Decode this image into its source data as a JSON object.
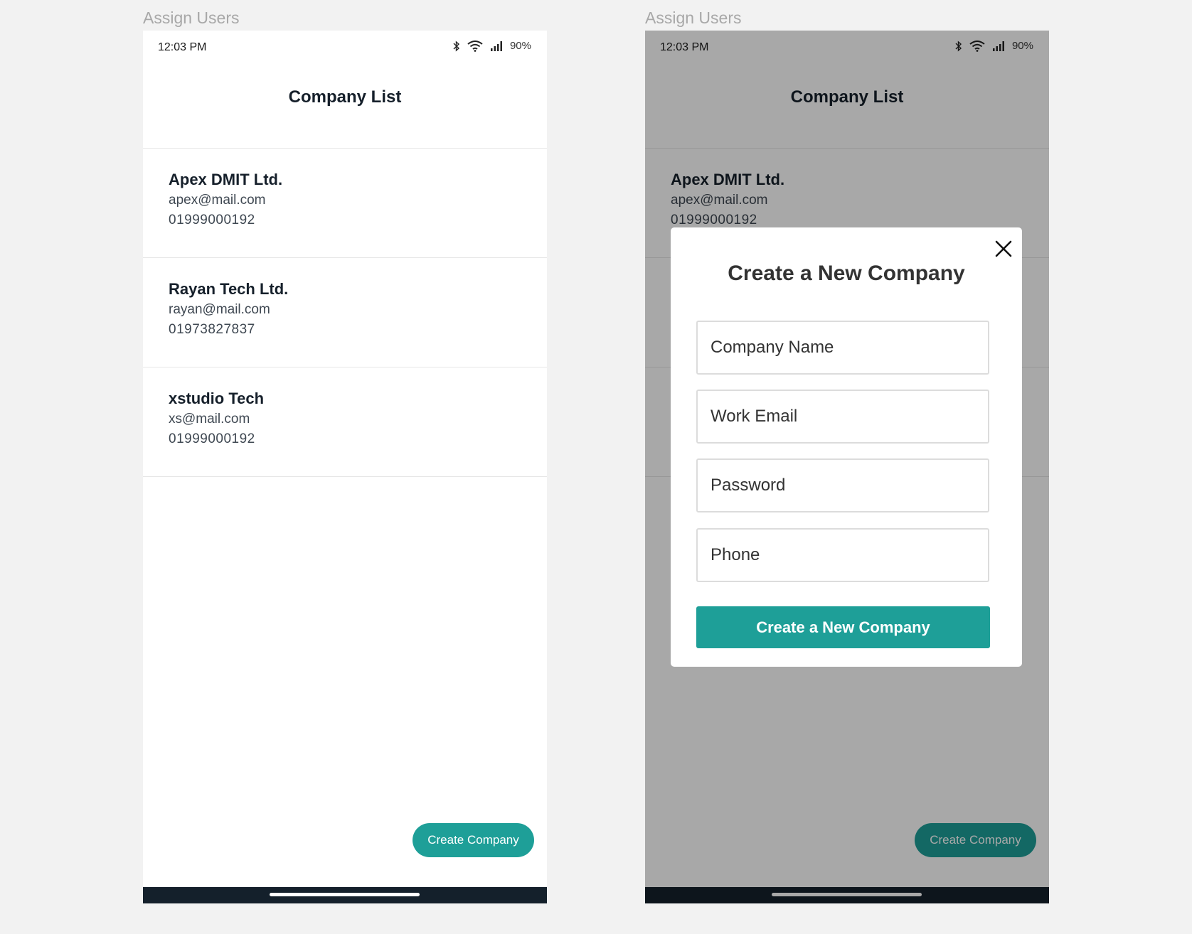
{
  "screens": [
    {
      "frame_label": "Assign Users",
      "status": {
        "time": "12:03 PM",
        "battery": "90%"
      },
      "appbar": {
        "title": "Company List"
      },
      "companies": [
        {
          "name": "Apex DMIT Ltd.",
          "email": "apex@mail.com",
          "phone": "01999000192"
        },
        {
          "name": "Rayan Tech Ltd.",
          "email": "rayan@mail.com",
          "phone": "01973827837"
        },
        {
          "name": "xstudio Tech",
          "email": "xs@mail.com",
          "phone": "01999000192"
        }
      ],
      "fab_label": "Create Company"
    },
    {
      "frame_label": "Assign Users",
      "status": {
        "time": "12:03 PM",
        "battery": "90%"
      },
      "appbar": {
        "title": "Company List"
      },
      "companies": [
        {
          "name": "Apex DMIT Ltd.",
          "email": "apex@mail.com",
          "phone": "01999000192"
        }
      ],
      "fab_label": "Create Company",
      "modal": {
        "title": "Create a New Company",
        "fields": [
          {
            "placeholder": "Company Name"
          },
          {
            "placeholder": "Work Email"
          },
          {
            "placeholder": "Password"
          },
          {
            "placeholder": "Phone"
          }
        ],
        "submit_label": "Create a New Company"
      }
    }
  ],
  "colors": {
    "accent": "#1e9f98",
    "title_text": "#16202b",
    "navbar": "#14202b",
    "page_bg": "#f2f2f2"
  },
  "icons": [
    "bluetooth-icon",
    "wifi-icon",
    "signal-icon",
    "close-icon"
  ]
}
